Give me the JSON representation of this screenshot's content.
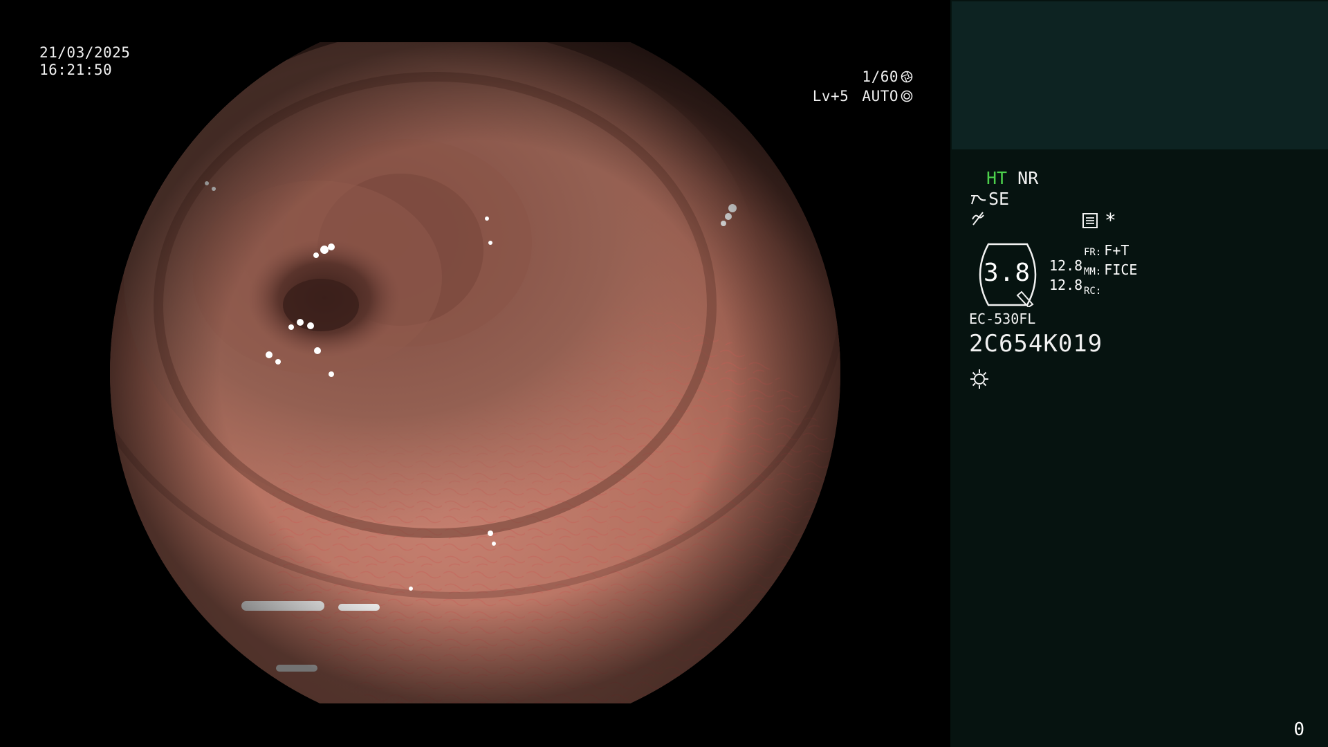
{
  "osd": {
    "date": "21/03/2025",
    "time": "16:21:50",
    "shutter": "1/60",
    "level": "Lv+5",
    "iris_mode": "AUTO"
  },
  "panel": {
    "mode_ht": "HT",
    "mode_nr": "NR",
    "se_label": "SE",
    "zoom_value": "3.8",
    "zoom_val_top": "12.8",
    "zoom_val_bottom": "12.8",
    "fr_label": "FR:",
    "fr_value": "F+T",
    "mm_label": "MM:",
    "mm_value": "FICE",
    "rc_label": "RC:",
    "rc_value": "",
    "star": "*",
    "scope_model": "EC-530FL",
    "scope_serial": "2C654K019",
    "counter": "0"
  },
  "icons": {
    "shutter": "aperture-icon",
    "iris": "iris-icon",
    "structure": "structure-enhancement-icon",
    "color": "color-enhancement-icon",
    "settings": "settings-list-icon",
    "light": "light-source-icon"
  },
  "colors": {
    "accent_ht": "#4cd14c",
    "panel_bg": "#061310",
    "thumb_bg": "#0d2322"
  }
}
